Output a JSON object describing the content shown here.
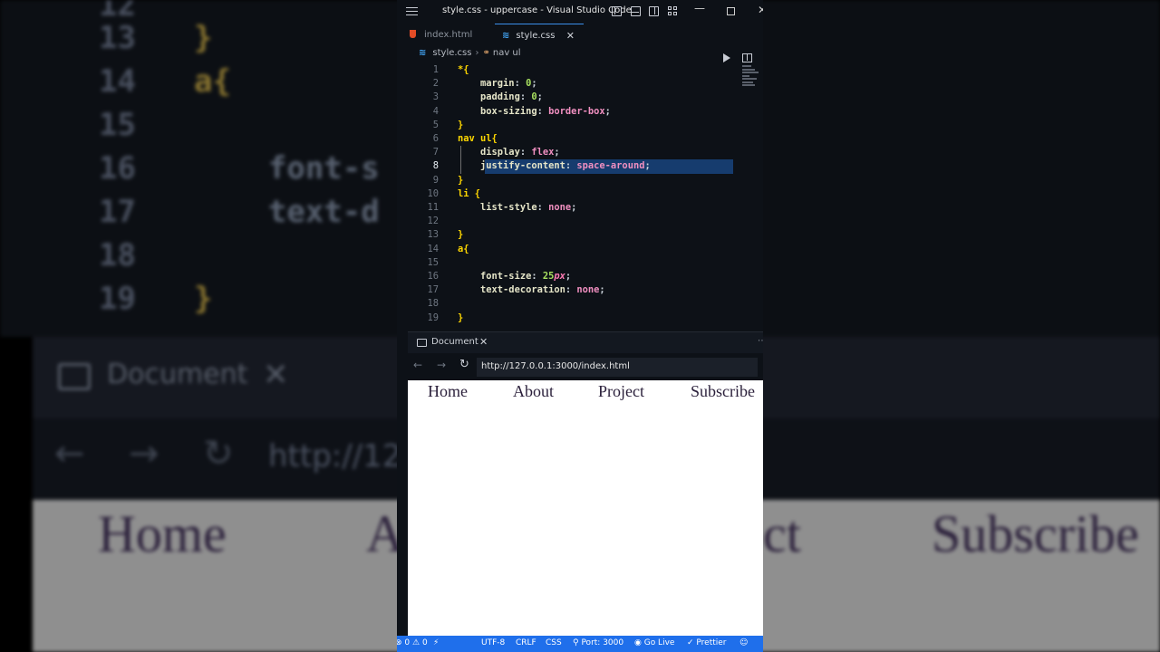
{
  "window": {
    "title": "style.css - uppercase - Visual Studio Code"
  },
  "tabs": [
    {
      "label": "index.html",
      "icon": "html-file-icon",
      "active": false
    },
    {
      "label": "style.css",
      "icon": "css-file-icon",
      "active": true
    }
  ],
  "breadcrumb": {
    "file": "style.css",
    "symbol": "nav ul"
  },
  "editor": {
    "active_line": 8,
    "lines": [
      {
        "n": "1",
        "text": "*{"
      },
      {
        "n": "2",
        "text": "    margin: 0;"
      },
      {
        "n": "3",
        "text": "    padding: 0;"
      },
      {
        "n": "4",
        "text": "    box-sizing: border-box;"
      },
      {
        "n": "5",
        "text": "}"
      },
      {
        "n": "6",
        "text": "nav ul{"
      },
      {
        "n": "7",
        "text": "    display: flex;"
      },
      {
        "n": "8",
        "text": "    justify-content: space-around;"
      },
      {
        "n": "9",
        "text": "}"
      },
      {
        "n": "10",
        "text": "li {"
      },
      {
        "n": "11",
        "text": "    list-style: none;"
      },
      {
        "n": "12",
        "text": ""
      },
      {
        "n": "13",
        "text": "}"
      },
      {
        "n": "14",
        "text": "a{"
      },
      {
        "n": "15",
        "text": ""
      },
      {
        "n": "16",
        "text": "    font-size: 25px;"
      },
      {
        "n": "17",
        "text": "    text-decoration: none;"
      },
      {
        "n": "18",
        "text": ""
      },
      {
        "n": "19",
        "text": "}"
      }
    ]
  },
  "preview": {
    "tab_label": "Document",
    "url": "http://127.0.0.1:3000/index.html",
    "nav_links": [
      "Home",
      "About",
      "Project",
      "Subscribe"
    ]
  },
  "background": {
    "line_numbers": [
      "12",
      "13",
      "14",
      "15",
      "16",
      "17",
      "18",
      "19"
    ],
    "code_lines": [
      "",
      "}",
      "a{",
      "",
      "    font-s",
      "    text-d",
      "",
      "}"
    ],
    "tab_label": "Document",
    "url_fragment": "http://127",
    "nav_links": [
      "Home",
      "A",
      "ct",
      "Subscribe"
    ]
  },
  "statusbar": {
    "problems": "0",
    "warnings": "0",
    "encoding": "UTF-8",
    "eol": "CRLF",
    "language": "CSS",
    "port": "Port: 3000",
    "go_live": "Go Live",
    "prettier": "Prettier"
  },
  "colors": {
    "statusbar": "#1f6feb",
    "selector": "#ffd700",
    "value": "#f08fc0",
    "number": "#a8e060",
    "line_highlight": "#163c6e"
  }
}
